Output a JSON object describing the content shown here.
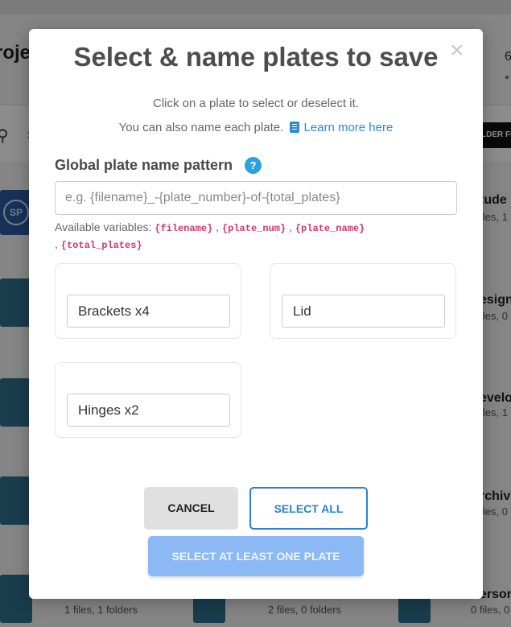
{
  "background": {
    "title": "roje",
    "right_number": "6",
    "search_letter": "S",
    "folder_button": "LDER FI",
    "cards": [
      {
        "title": "tude",
        "sub": "iles, 1"
      },
      {
        "title": "esign",
        "sub": "iles, 0"
      },
      {
        "title": "evelo",
        "sub": "iles, 1"
      },
      {
        "title": "rchive",
        "sub": "iles, 0"
      },
      {
        "title": "erson",
        "sub": "0 files, 0"
      }
    ],
    "bottom_cards": [
      {
        "sub": "1 files, 1 folders"
      },
      {
        "sub": "2 files, 0 folders"
      }
    ],
    "logo": "SP"
  },
  "modal": {
    "title": "Select & name plates to save",
    "close_label": "×",
    "intro_line1": "Click on a plate to select or deselect it.",
    "intro_line2": "You can also name each plate.",
    "learn_more": "Learn more here",
    "pattern_label": "Global plate name pattern",
    "help_label": "?",
    "pattern_placeholder": "e.g. {filename}_-{plate_number}-of-{total_plates}",
    "vars_prefix": "Available variables:",
    "variables": [
      "{filename}",
      "{plate_num}",
      "{plate_name}",
      "{total_plates}"
    ],
    "separator": ",",
    "plates": [
      {
        "name": "Brackets x4"
      },
      {
        "name": "Lid"
      },
      {
        "name": "Hinges x2"
      }
    ],
    "cancel_label": "CANCEL",
    "select_all_label": "SELECT ALL",
    "save_label": "SELECT AT LEAST ONE PLATE"
  },
  "colors": {
    "accent": "#2a7fd8",
    "disabled_button": "#8cb8f4",
    "variable": "#d6336c",
    "help": "#2aa3dc"
  }
}
